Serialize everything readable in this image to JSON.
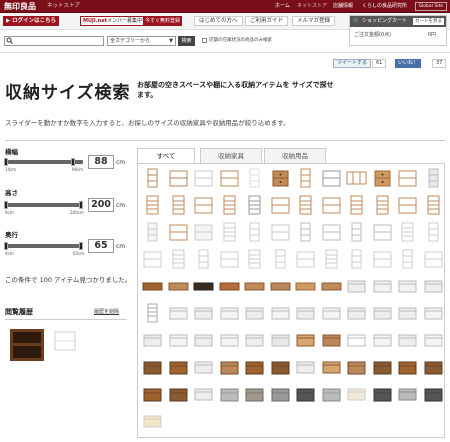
{
  "header": {
    "logo": "無印良品",
    "store": "ネットストア",
    "nav": [
      "ホーム",
      "ネットストア",
      "店舗情報",
      "くらしの良品研究所"
    ],
    "global_site": "Global Site"
  },
  "subheader": {
    "login": "ログインはこちら",
    "muji_net_prefix": "MUJI.net",
    "muji_net_rest": "メンバー募集中!",
    "register": "今すぐ無料登録",
    "help_links": [
      "はじめての方へ",
      "ご利用ガイド",
      "メルマガ登録"
    ]
  },
  "cart": {
    "title": "ショッピングカート",
    "view_button": "カートを見る",
    "total_label": "ご注文金額(0点)",
    "total_value": "0円"
  },
  "search": {
    "query": "Q",
    "category": "全カテゴリーから",
    "button": "検索",
    "stock_only_label": "店舗の在庫状況の商品のみ検索"
  },
  "social": {
    "tweet": "ツイートする",
    "tweet_count": "61",
    "like": "いいね！",
    "like_count": "37"
  },
  "page": {
    "title": "収納サイズ検索",
    "subtitle": "お部屋の空きスペースや棚に入る収納アイテムを サイズで探せます。",
    "intro": "スライダーを動かすか数字を入力すると、お探しのサイズの収納家具や収納用品が絞り込めます。"
  },
  "sliders": {
    "width": {
      "label": "横幅",
      "min": "14cm",
      "max": "99cm",
      "value": "88",
      "unit": "cm",
      "level": 0.87
    },
    "height": {
      "label": "高さ",
      "min": "9cm",
      "max": "200cm",
      "value": "200",
      "unit": "cm",
      "level": 1.0
    },
    "depth": {
      "label": "奥行",
      "min": "4cm",
      "max": "65cm",
      "value": "65",
      "unit": "cm",
      "level": 1.0
    }
  },
  "result_text": "この条件で 100 アイテム見つかりました。",
  "history": {
    "label": "閲覧履歴",
    "clear": "履歴を削除"
  },
  "tabs": [
    "すべて",
    "収納家具",
    "収納用品"
  ]
}
